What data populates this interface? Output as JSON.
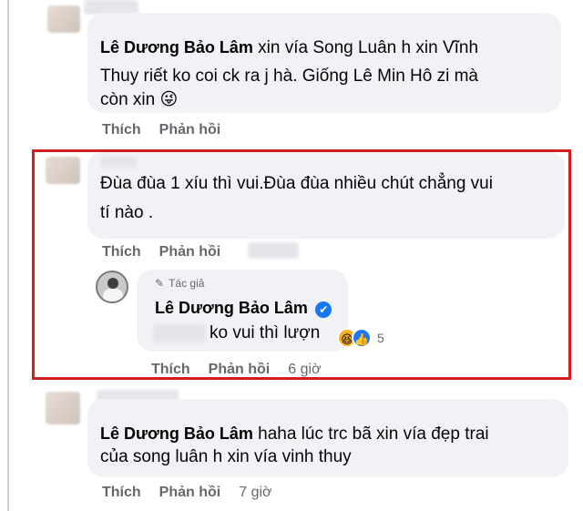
{
  "comments": [
    {
      "author": "Lê Dương Bảo Lâm",
      "text_line1": "xin vía Song Luân h xin Vĩnh",
      "text_line2": "Thuy riết ko coi ck ra j hà. Giống Lê Min Hô zi mà",
      "text_line3": "còn xin",
      "emoji": "😜",
      "like": "Thích",
      "reply": "Phản hồi"
    },
    {
      "text_line1": "Đùa đùa 1 xíu thì vui.Đùa đùa nhiều chút chẳng vui",
      "text_line2": "tí nào .",
      "like": "Thích",
      "reply": "Phản hồi"
    },
    {
      "author_tag": "Tác giả",
      "author": "Lê Dương Bảo Lâm",
      "verified_icon": "✔",
      "text": "ko vui thì lượn",
      "reaction_count": "5",
      "like": "Thích",
      "reply": "Phản hồi",
      "time": "6 giờ"
    },
    {
      "author": "Lê Dương Bảo Lâm",
      "text_line1": "haha lúc trc bã xin vía đẹp trai",
      "text_line2": "của song luân h xin vía vinh thuy",
      "like": "Thích",
      "reply": "Phản hồi",
      "time": "7 giờ"
    }
  ],
  "colors": {
    "highlight": "#d41e1e",
    "verified": "#1877f2",
    "bubble": "#f0f2f5"
  }
}
